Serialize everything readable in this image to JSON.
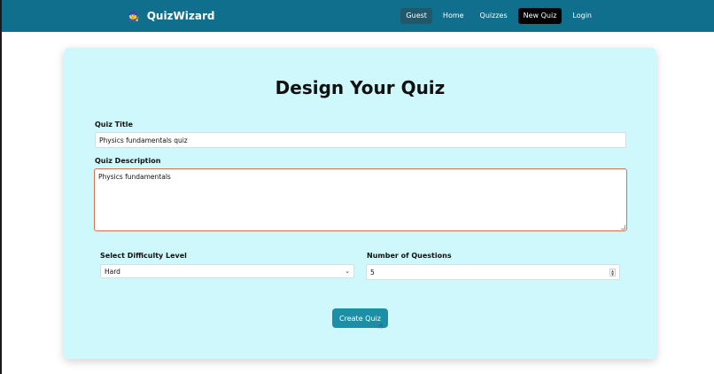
{
  "app": {
    "brand_name": "QuizWizard",
    "brand_icon": "wizard-icon"
  },
  "nav": {
    "items": [
      {
        "label": "Guest",
        "state": "user-badge"
      },
      {
        "label": "Home",
        "state": "normal"
      },
      {
        "label": "Quizzes",
        "state": "normal"
      },
      {
        "label": "New Quiz",
        "state": "active"
      },
      {
        "label": "Login",
        "state": "normal"
      }
    ]
  },
  "form": {
    "heading": "Design Your Quiz",
    "title_label": "Quiz Title",
    "title_value": "Physics fundamentals quiz",
    "description_label": "Quiz Description",
    "description_value": "Physics fundamentals",
    "difficulty_label": "Select Difficulty Level",
    "difficulty_value": "Hard",
    "questions_label": "Number of Questions",
    "questions_value": "5",
    "submit_label": "Create Quiz"
  },
  "colors": {
    "navbar": "#0f6f8c",
    "card_bg": "#cff8fc",
    "button": "#1c8fa6",
    "focus_border": "#d9714e"
  }
}
